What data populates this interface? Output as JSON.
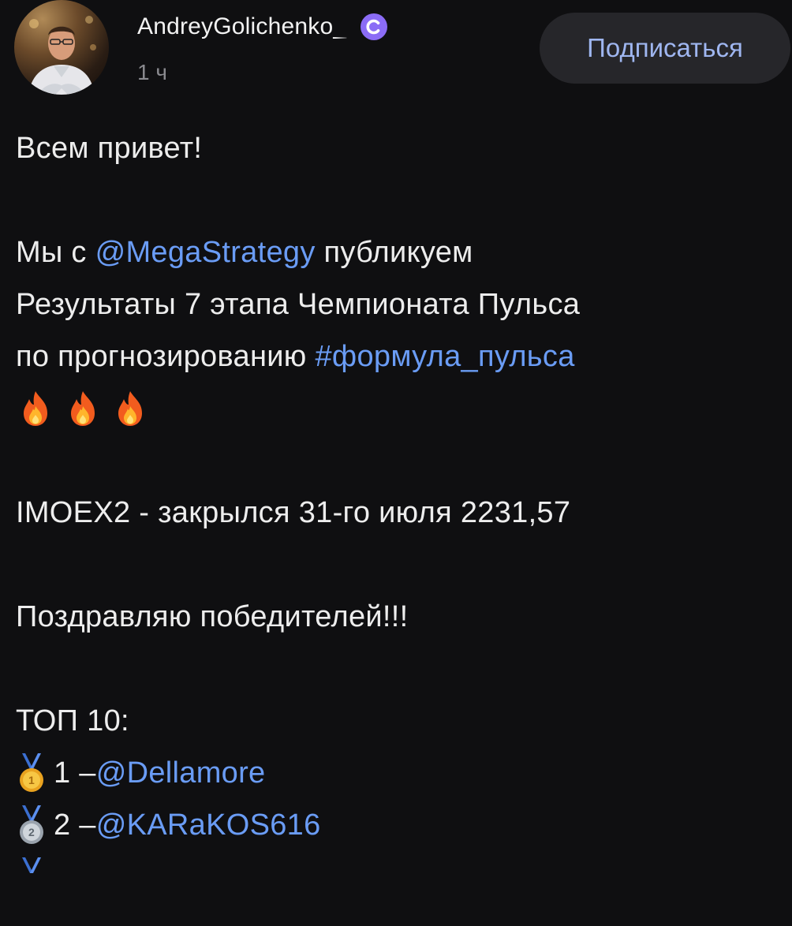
{
  "author": {
    "name": "AndreyGolichenko_",
    "time": "1 ч",
    "badge_icon": "verified-c-badge-icon",
    "badge_color": "#8b6cf6"
  },
  "subscribe_label": "Подписаться",
  "post": {
    "greeting": "Всем привет!",
    "line1_pre": "Мы с ",
    "mention_strategy": "@MegaStrategy",
    "line1_post": " публикуем",
    "line2": "Результаты 7 этапа Чемпионата Пульса",
    "line3_pre": "по прогнозированию ",
    "hashtag": "#формула_пульса",
    "fire_icons": [
      "fire-emoji-icon",
      "fire-emoji-icon",
      "fire-emoji-icon"
    ],
    "imoex": "IMOEX2 - закрылся 31-го июля 2231,57",
    "congrats": "Поздравляю победителей!!!",
    "top_title": "ТОП 10:",
    "winners": [
      {
        "medal": "gold-medal-icon",
        "place": "1 – ",
        "user": "@Dellamore"
      },
      {
        "medal": "silver-medal-icon",
        "place": "2 – ",
        "user": "@KARaKOS616"
      }
    ],
    "link_color": "#6a9cf5"
  }
}
